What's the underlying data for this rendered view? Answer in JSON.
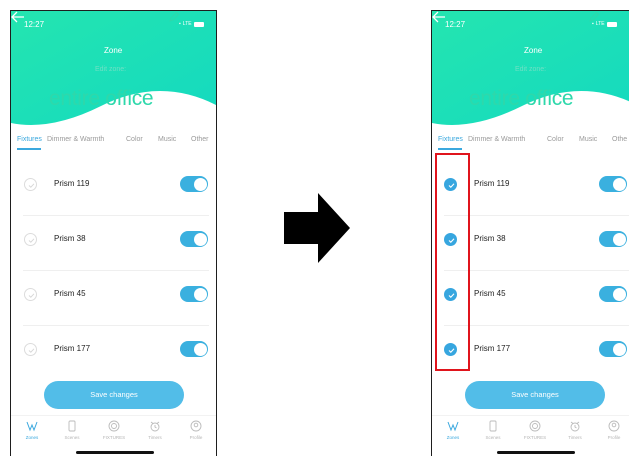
{
  "left_screen": {
    "status": {
      "time": "12:27",
      "network": "LTE"
    },
    "header": {
      "title": "Zone",
      "edit_label": "Edit zone:",
      "zone_name": "entire office"
    },
    "tabs": [
      {
        "label": "Fixtures",
        "active": true
      },
      {
        "label": "Dimmer & Warmth",
        "active": false
      },
      {
        "label": "Color",
        "active": false
      },
      {
        "label": "Music",
        "active": false
      },
      {
        "label": "Other",
        "active": false
      }
    ],
    "fixtures": [
      {
        "label": "Prism 119",
        "checked": false,
        "toggle_on": true
      },
      {
        "label": "Prism 38",
        "checked": false,
        "toggle_on": true
      },
      {
        "label": "Prism 45",
        "checked": false,
        "toggle_on": true
      },
      {
        "label": "Prism 177",
        "checked": false,
        "toggle_on": true
      }
    ],
    "save_label": "Save changes",
    "tabbar": [
      {
        "label": "Zones",
        "icon": "zones-icon",
        "active": true
      },
      {
        "label": "Scenes",
        "icon": "scenes-icon",
        "active": false
      },
      {
        "label": "FIXTURES",
        "icon": "fixtures-icon",
        "active": false
      },
      {
        "label": "Timers",
        "icon": "timer-icon",
        "active": false
      },
      {
        "label": "Profile",
        "icon": "profile-icon",
        "active": false
      }
    ]
  },
  "right_screen": {
    "status": {
      "time": "12:27",
      "network": "LTE"
    },
    "header": {
      "title": "Zone",
      "edit_label": "Edit zone:",
      "zone_name": "entire office"
    },
    "tabs": [
      {
        "label": "Fixtures",
        "active": true
      },
      {
        "label": "Dimmer & Warmth",
        "active": false
      },
      {
        "label": "Color",
        "active": false
      },
      {
        "label": "Music",
        "active": false
      },
      {
        "label": "Othe",
        "active": false
      }
    ],
    "fixtures": [
      {
        "label": "Prism 119",
        "checked": true,
        "toggle_on": true
      },
      {
        "label": "Prism 38",
        "checked": true,
        "toggle_on": true
      },
      {
        "label": "Prism 45",
        "checked": true,
        "toggle_on": true
      },
      {
        "label": "Prism 177",
        "checked": true,
        "toggle_on": true
      }
    ],
    "save_label": "Save changes",
    "tabbar": [
      {
        "label": "Zones",
        "icon": "zones-icon",
        "active": true
      },
      {
        "label": "Scenes",
        "icon": "scenes-icon",
        "active": false
      },
      {
        "label": "FIXTURES",
        "icon": "fixtures-icon",
        "active": false
      },
      {
        "label": "Timers",
        "icon": "timer-icon",
        "active": false
      },
      {
        "label": "Profile",
        "icon": "profile-icon",
        "active": false
      }
    ]
  },
  "colors": {
    "accent": "#3aa8de",
    "header_green": "#1fe3a8",
    "highlight_red": "#e0141c"
  }
}
